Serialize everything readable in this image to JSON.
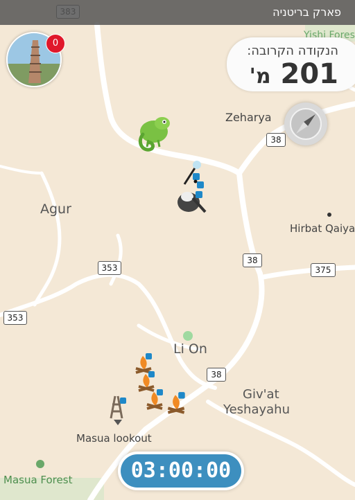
{
  "header": {
    "park_name": "פארק בריטניה"
  },
  "profile": {
    "badge_count": "0"
  },
  "nearest_point": {
    "label": "הנקודה הקרובה:",
    "distance": "201",
    "unit": "מ'"
  },
  "map": {
    "place_labels": [
      "Zeharya",
      "Agur",
      "Hirbat Qaiya",
      "Li On",
      "Giv'at",
      "Yeshayahu",
      "Masua lookout",
      "Masua Forest",
      "Yishi Forest"
    ],
    "road_shields": [
      "383",
      "38",
      "353",
      "38",
      "375",
      "353",
      "38"
    ]
  },
  "timer": {
    "value": "03:00:00"
  },
  "colors": {
    "timer_bg": "#3d8fbf",
    "badge": "#e0182b",
    "land": "#f4e8d6",
    "road": "#ffffff"
  }
}
